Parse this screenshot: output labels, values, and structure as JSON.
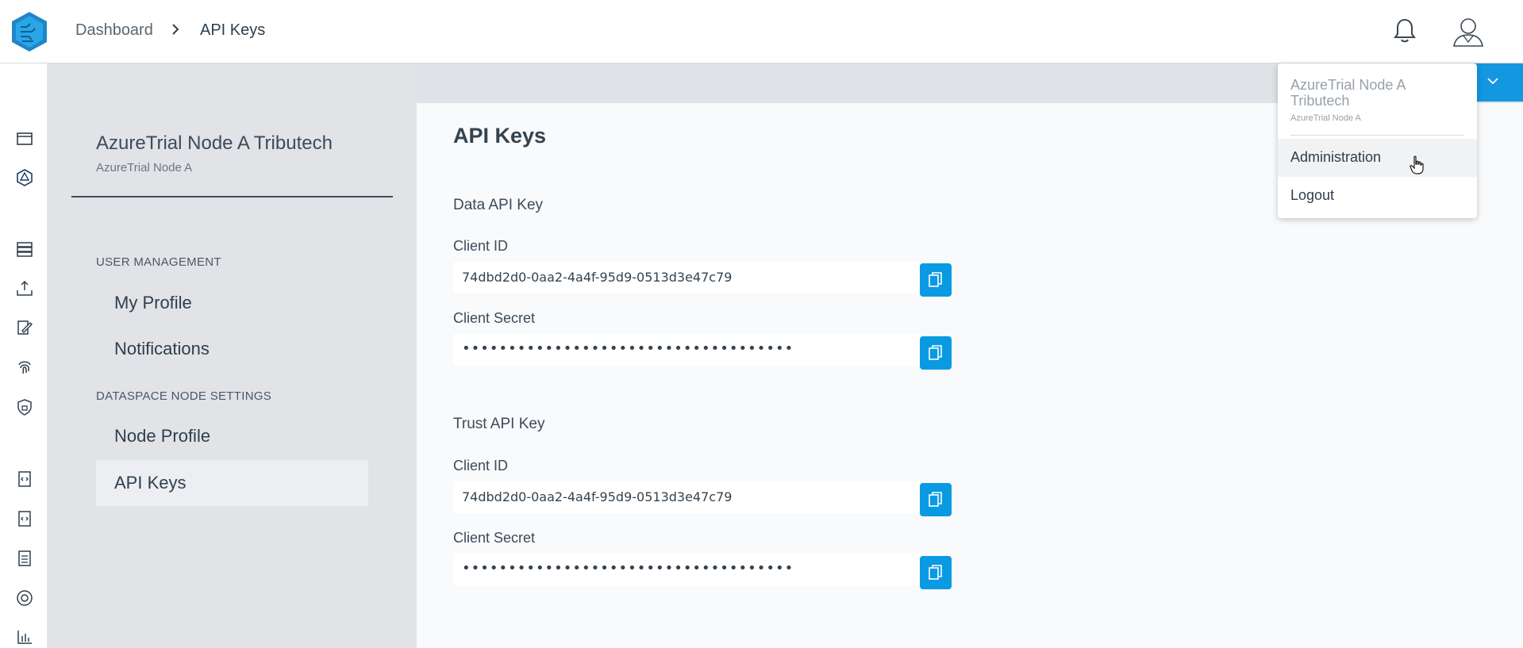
{
  "header": {
    "breadcrumb": [
      "Dashboard",
      "API Keys"
    ],
    "icons": [
      "app-logo-icon",
      "bell-icon",
      "user-avatar-icon"
    ]
  },
  "rail": {
    "icons": [
      "window-icon",
      "network-icon",
      "database-icon",
      "upload-icon",
      "edit-document-icon",
      "fingerprint-icon",
      "shield-icon",
      "code-file-icon",
      "code-file-alt-icon",
      "document-icon",
      "help-icon",
      "bar-chart-icon"
    ]
  },
  "settings": {
    "org_name": "AzureTrial Node A Tributech",
    "org_sub": "AzureTrial Node A",
    "sections": [
      {
        "heading": "USER MANAGEMENT",
        "items": [
          "My Profile",
          "Notifications"
        ]
      },
      {
        "heading": "DATASPACE NODE SETTINGS",
        "items": [
          "Node Profile",
          "API Keys"
        ]
      }
    ],
    "active_item": "API Keys"
  },
  "main": {
    "title": "API Keys",
    "groups": [
      {
        "title": "Data API Key",
        "client_id_label": "Client ID",
        "client_id": "74dbd2d0-0aa2-4a4f-95d9-0513d3e47c79",
        "client_secret_label": "Client Secret",
        "client_secret": "••••••••••••••••••••••••••••••••••••"
      },
      {
        "title": "Trust API Key",
        "client_id_label": "Client ID",
        "client_id": "74dbd2d0-0aa2-4a4f-95d9-0513d3e47c79",
        "client_secret_label": "Client Secret",
        "client_secret": "••••••••••••••••••••••••••••••••••••"
      }
    ]
  },
  "menu": {
    "title": "AzureTrial Node A Tributech",
    "sub": "AzureTrial Node A",
    "items": [
      "Administration",
      "Logout"
    ],
    "hovered": "Administration"
  },
  "colors": {
    "accent": "#0a9ae2",
    "panel_bg": "#e1e3e7",
    "text": "#2f3e4c"
  }
}
